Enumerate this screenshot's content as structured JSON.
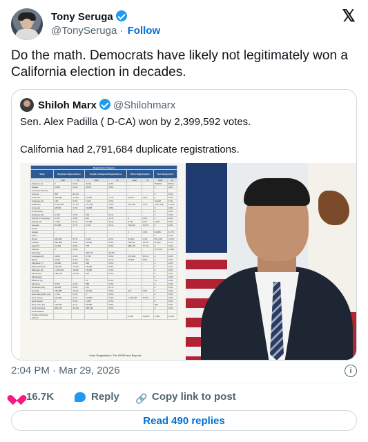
{
  "author": {
    "name": "Tony Seruga",
    "handle": "@TonySeruga",
    "follow_label": "Follow"
  },
  "tweet_text": "Do the math. Democrats have likely not legitimately won a California election in decades.",
  "quoted": {
    "name": "Shiloh Marx",
    "handle": "@Shilohmarx",
    "text": "Sen. Alex Padilla ( D-CA) won by 2,399,592 votes.\n\nCalifornia had 2,791,684 duplicate registrations."
  },
  "document_image": {
    "caption": "Registration Category",
    "columns": [
      "State",
      "Duplicate Registrations",
      "Invalid or Rejected Registrations",
      "Other Registrations",
      "Not Categorized"
    ],
    "subcolumns": [
      "Total",
      "%",
      "Total",
      "%",
      "Total",
      "%",
      "Total",
      "%"
    ],
    "rows": [
      [
        "Alabama (1)",
        "0",
        "0.0%",
        "3,840",
        "0.0%",
        "-",
        "-",
        "356,667",
        "38.1%"
      ],
      [
        "Alaska",
        "5,580",
        "0.4%",
        "8,038",
        "0.8%",
        "-",
        "-",
        "0",
        "0.0%"
      ],
      [
        "American Samoa",
        "",
        "",
        "",
        "",
        "",
        "",
        "",
        ""
      ],
      [
        "Arizona",
        "506",
        "99.1%",
        "-",
        "-",
        "-",
        "-",
        "0",
        "0.0%"
      ],
      [
        "Arkansas",
        "434,886",
        "14.8%",
        "77,835",
        "1.7%",
        "12,677",
        "0.6%",
        "0",
        "0.0%"
      ],
      [
        "Arkansas (2)",
        "128",
        "0.0%",
        "7,222",
        "2.2%",
        "-",
        "-",
        "13,228",
        "4.0%"
      ],
      [
        "California",
        "2,791,684",
        "27.7%",
        "277,044",
        "2.9%",
        "379,022",
        "3.7%",
        "1,447,782",
        "14.4%"
      ],
      [
        "Colorado",
        "48,609",
        "1.9%",
        "16,828",
        "0.8%",
        "-",
        "-",
        "0",
        "0.0%"
      ],
      [
        "Connecticut",
        "-",
        "-",
        "-",
        "-",
        "-",
        "-",
        "0",
        "0.0%"
      ],
      [
        "Delaware (3)",
        "3,738",
        "1.5%",
        "235",
        "0.1%",
        "-",
        "-",
        "0",
        "0.0%"
      ],
      [
        "District of Columbia",
        "3,725",
        "3.8%",
        "807",
        "1.1%",
        "0",
        "0.0%",
        "0",
        "0.0%"
      ],
      [
        "Florida (4)",
        "1,468",
        "0.1%",
        "72,289",
        "2.1%",
        "8,775",
        "0.1%",
        "2,016",
        "0.0%"
      ],
      [
        "Georgia",
        "87,908",
        "2.7%",
        "3,741",
        "0.1%",
        "735,947",
        "18.4%",
        "0",
        "0.0%"
      ],
      [
        "Guam",
        "",
        "",
        "",
        "",
        "",
        "",
        "",
        ""
      ],
      [
        "Hawaii",
        "-",
        "-",
        "-",
        "-",
        "0",
        "0.0%",
        "84,085",
        "41.7%"
      ],
      [
        "Idaho",
        "-",
        "-",
        "-",
        "-",
        "-",
        "-",
        "0",
        "0.0%"
      ],
      [
        "Illinois",
        "345,925",
        "8.7%",
        "8,124",
        "0.2%",
        "94,434",
        "2.4%",
        "564,138",
        "14.1%"
      ],
      [
        "Indiana",
        "356,028",
        "9.9%",
        "18,987",
        "0.5%",
        "168,411",
        "10.0%",
        "11,063",
        "0.7%"
      ],
      [
        "Iowa (5)",
        "10,303",
        "0.8%",
        "378",
        "0.0%",
        "488,776",
        "77.1%",
        "0",
        "0.0%"
      ],
      [
        "Kansas",
        "0",
        "0.0%",
        "-",
        "-",
        "-",
        "-",
        "173,705",
        "14.8%"
      ],
      [
        "Kentucky",
        "-",
        "-",
        "318,774",
        "23.8%",
        "-",
        "-",
        "-",
        "-"
      ],
      [
        "Louisiana (6)",
        "6,895",
        "1.5%",
        "8,793",
        "2.0%",
        "179,292",
        "35.2%",
        "0",
        "0.0%"
      ],
      [
        "Maine",
        "3,638",
        "0.9%",
        "547",
        "0.1%",
        "10,687",
        "5.6%",
        "0",
        "0.0%"
      ],
      [
        "Maryland (7)",
        "34,080",
        "0.9%",
        "495",
        "0.0%",
        "-",
        "-",
        "0",
        "0.0%"
      ],
      [
        "Massachusetts",
        "218,787",
        "10.3%",
        "18,490",
        "0.8%",
        "-",
        "-",
        "0",
        "0.0%"
      ],
      [
        "Michigan (8)",
        "1,206,903",
        "18.8%",
        "18,280",
        "0.3%",
        "-",
        "-",
        "0",
        "0.0%"
      ],
      [
        "Minnesota",
        "198,475",
        "10.4%",
        "326",
        "0.0%",
        "-",
        "-",
        "0",
        "0.0%"
      ],
      [
        "Mississippi",
        "-",
        "-",
        "-",
        "-",
        "-",
        "-",
        "0",
        "0.0%"
      ],
      [
        "Missouri (9)",
        "-",
        "-",
        "13",
        "0.0%",
        "-",
        "-",
        "13",
        "0.0%"
      ],
      [
        "Montana",
        "3,763",
        "1.4%",
        "685",
        "0.2%",
        "-",
        "-",
        "0",
        "0.0%"
      ],
      [
        "Nebraska (10)",
        "49,658",
        "8.0%",
        "207",
        "0.1%",
        "-",
        "-",
        "0",
        "0.0%"
      ],
      [
        "Nevada",
        "155,855",
        "11.0%",
        "92,643",
        "6.5%",
        "341",
        "0.0%",
        "0",
        "0.0%"
      ],
      [
        "New Hampshire (11)",
        "1,740",
        "0.4%",
        "0",
        "0.0%",
        "-",
        "-",
        "0",
        "0.0%"
      ],
      [
        "New Jersey",
        "104,000",
        "4.1%",
        "10,884",
        "0.4%",
        "1,016,043",
        "39.5%",
        "0",
        "0.0%"
      ],
      [
        "New Mexico",
        "0",
        "0.0%",
        "1,683",
        "0.2%",
        "-",
        "-",
        "0",
        "0.0%"
      ],
      [
        "New York (12)",
        "159,051",
        "4.1%",
        "94,880",
        "0.8%",
        "-",
        "-",
        "288",
        "0.0%"
      ],
      [
        "North Carolina",
        "869,473",
        "19.4%",
        "298,799",
        "6.6%",
        "-",
        "-",
        "0",
        "0.0%"
      ],
      [
        "North Dakota",
        "",
        "",
        "",
        "",
        "",
        "",
        "",
        ""
      ],
      [
        "Northern Mariana Islands",
        "-",
        "-",
        "-",
        "-",
        "8,546",
        "136.0%",
        "1,450",
        "23.0%"
      ]
    ],
    "footer": "Voter Registration: The NVRA and Beyond"
  },
  "timestamp": "2:04 PM · Mar 29, 2026",
  "actions": {
    "likes": "16.7K",
    "reply_label": "Reply",
    "copy_link_label": "Copy link to post"
  },
  "read_replies_label": "Read 490 replies",
  "colors": {
    "accent": "#1d9bf0",
    "link": "#006fd6",
    "like": "#f91880",
    "muted": "#536471"
  }
}
